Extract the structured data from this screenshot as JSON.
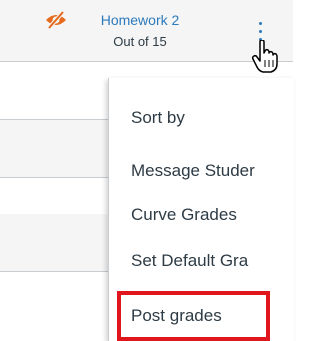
{
  "column_header": {
    "title": "Homework 2",
    "subtitle": "Out of 15",
    "hidden_icon": "eye-slash-icon",
    "options_icon": "kebab-menu-icon"
  },
  "menu": {
    "items": [
      {
        "label": "Sort by"
      },
      {
        "label": "Message Studer"
      },
      {
        "label": "Curve Grades"
      },
      {
        "label": "Set Default Gra"
      },
      {
        "label": "Post grades"
      }
    ]
  },
  "colors": {
    "accent": "#2b7abc",
    "hidden_icon": "#e66a1e",
    "highlight": "#e0161c",
    "text": "#2d3b45"
  }
}
